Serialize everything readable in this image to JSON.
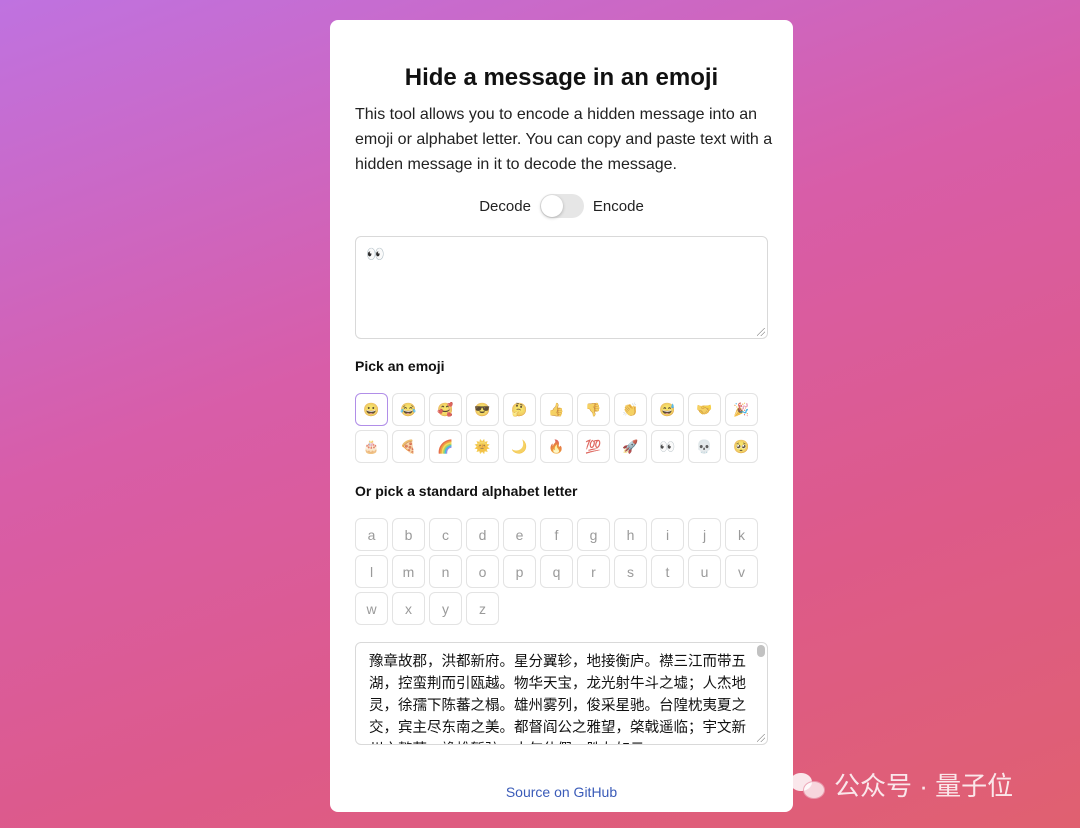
{
  "title": "Hide a message in an emoji",
  "description": "This tool allows you to encode a hidden message into an emoji or alphabet letter. You can copy and paste text with a hidden message in it to decode the message.",
  "mode_toggle": {
    "left_label": "Decode",
    "right_label": "Encode",
    "state": "Decode"
  },
  "input_textarea": {
    "value": "👀"
  },
  "emoji_section": {
    "label": "Pick an emoji",
    "selected_index": 0,
    "emojis": [
      "😀",
      "😂",
      "🥰",
      "😎",
      "🤔",
      "👍",
      "👎",
      "👏",
      "😅",
      "🤝",
      "🎉",
      "🎂",
      "🍕",
      "🌈",
      "🌞",
      "🌙",
      "🔥",
      "💯",
      "🚀",
      "👀",
      "💀",
      "🥺"
    ]
  },
  "letter_section": {
    "label": "Or pick a standard alphabet letter",
    "letters": [
      "a",
      "b",
      "c",
      "d",
      "e",
      "f",
      "g",
      "h",
      "i",
      "j",
      "k",
      "l",
      "m",
      "n",
      "o",
      "p",
      "q",
      "r",
      "s",
      "t",
      "u",
      "v",
      "w",
      "x",
      "y",
      "z"
    ]
  },
  "output_textarea": {
    "value": "豫章故郡，洪都新府。星分翼轸，地接衡庐。襟三江而带五湖，控蛮荆而引瓯越。物华天宝，龙光射牛斗之墟；人杰地灵，徐孺下陈蕃之榻。雄州雾列，俊采星驰。台隍枕夷夏之交，宾主尽东南之美。都督阎公之雅望，棨戟遥临；宇文新州之懿范，襜帷暂驻。十旬休假，胜友如云；"
  },
  "footer": {
    "source_link": "Source on GitHub"
  },
  "watermark": {
    "text": "公众号 · 量子位"
  }
}
